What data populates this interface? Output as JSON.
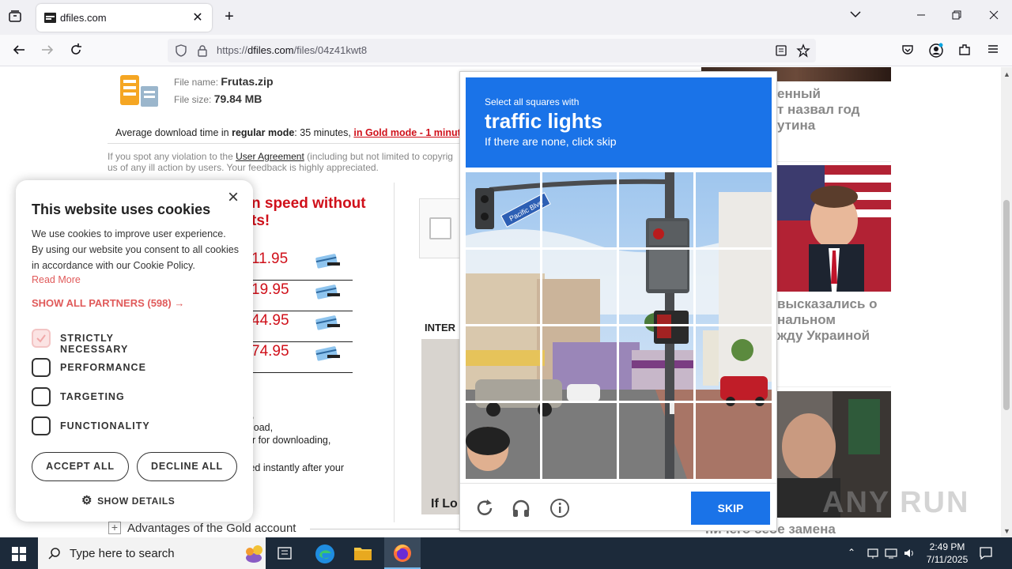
{
  "browser": {
    "tab_title": "dfiles.com",
    "url_prefix": "https://",
    "url_domain": "dfiles.com",
    "url_path": "/files/04z41kwt8"
  },
  "page": {
    "file_name_label": "File name:",
    "file_name": "Frutas.zip",
    "file_size_label": "File size:",
    "file_size": "79.84 MB",
    "avg_time_prefix": "Average download time in",
    "regular_mode": "regular mode",
    "avg_time_mid": ": 35 minutes,",
    "gold_mode_link": "in Gold mode - 1 minut",
    "violation_text_1": "If you spot any violation to the",
    "user_agreement_link": "User Agreement",
    "violation_text_2": "(including but not limited to copyrig",
    "violation_text_3": "us of any ill action by users. Your feedback is highly appreciated.",
    "promo_heading_1": "n speed without",
    "promo_heading_2": "ts!",
    "prices": [
      "11.95",
      "19.95",
      "44.95",
      "74.95"
    ],
    "list_frag_1": ",",
    "list_frag_2": "load,",
    "list_frag_3": "er for downloading,",
    "list_frag_4": "ted instantly after your",
    "inter_label": "INTER",
    "if_lo_label": "If Lo",
    "advantages_plus": "+",
    "advantages_text": "Advantages of the Gold account",
    "news_1": [
      "енный",
      "т назвал год",
      "утина"
    ],
    "news_2": [
      "высказались о",
      "нальном",
      "жду Украиной"
    ],
    "news_3": "ничего себе замена",
    "watermark": "ANY RUN"
  },
  "cookie": {
    "title": "This website uses cookies",
    "description": "We use cookies to improve user experience. By using our website you consent to all cookies in accordance with our Cookie Policy.",
    "read_more": "Read More",
    "show_partners": "SHOW ALL PARTNERS (598) →",
    "options": [
      {
        "label": "STRICTLY NECESSARY",
        "checked": true
      },
      {
        "label": "PERFORMANCE",
        "checked": false
      },
      {
        "label": "TARGETING",
        "checked": false
      },
      {
        "label": "FUNCTIONALITY",
        "checked": false
      }
    ],
    "accept_all": "ACCEPT ALL",
    "decline_all": "DECLINE ALL",
    "show_details": "SHOW DETAILS",
    "close": "×"
  },
  "captcha": {
    "instruction_small": "Select all squares with",
    "target": "traffic lights",
    "hint": "If there are none, click skip",
    "skip": "SKIP",
    "street_sign": "Pacific Blvd"
  },
  "taskbar": {
    "search_placeholder": "Type here to search",
    "time": "2:49 PM",
    "date": "7/11/2025"
  },
  "colors": {
    "captcha_blue": "#1a73e8",
    "promo_red": "#d0101a",
    "cookie_accent": "#e05a5a",
    "taskbar_bg": "#1c2a3a"
  }
}
